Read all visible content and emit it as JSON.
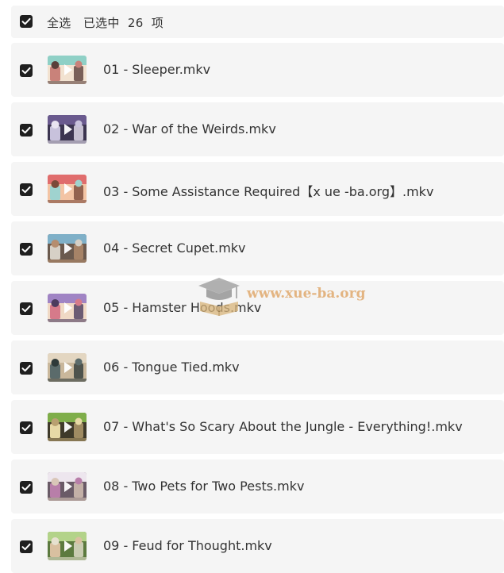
{
  "header": {
    "select_all": "全选",
    "selected_prefix": "已选中",
    "selected_count": "26",
    "selected_suffix": "项",
    "checked": true
  },
  "files": [
    {
      "name": "01 - Sleeper.mkv",
      "checked": true,
      "palette": [
        "#8fd0c6",
        "#c9827a",
        "#f2e2d0",
        "#5a3f3a"
      ]
    },
    {
      "name": "02 - War of the Weirds.mkv",
      "checked": true,
      "palette": [
        "#6a5a8e",
        "#c8c2dc",
        "#3c3550",
        "#e9e4f1"
      ]
    },
    {
      "name": "03 - Some Assistance Required【x ue -ba.org】.mkv",
      "checked": true,
      "palette": [
        "#e06d6d",
        "#9fd3cf",
        "#f3c4a4",
        "#7b4a3a"
      ]
    },
    {
      "name": "04 - Secret Cupet.mkv",
      "checked": true,
      "palette": [
        "#7fb0c8",
        "#d6d0c6",
        "#6b5a4e",
        "#b58d6e"
      ]
    },
    {
      "name": "05 - Hamster Hoods.mkv",
      "checked": true,
      "palette": [
        "#a084c4",
        "#d67a8a",
        "#f0d9c5",
        "#4b3b5e"
      ]
    },
    {
      "name": "06 - Tongue Tied.mkv",
      "checked": true,
      "palette": [
        "#e3d6c1",
        "#5b6b6b",
        "#c9b79b",
        "#2f3a3a"
      ]
    },
    {
      "name": "07 - What's So Scary About the Jungle - Everything!.mkv",
      "checked": true,
      "palette": [
        "#7fae4a",
        "#e7d9a6",
        "#3f3a2a",
        "#b8a070"
      ]
    },
    {
      "name": "08 - Two Pets for Two Pests.mkv",
      "checked": true,
      "palette": [
        "#ede6ee",
        "#b87ea9",
        "#6a5b67",
        "#d9c6b8"
      ]
    },
    {
      "name": "09 - Feud for Thought.mkv",
      "checked": true,
      "palette": [
        "#b3d389",
        "#d9c0a0",
        "#5c7a3f",
        "#e6e1cf"
      ]
    }
  ],
  "watermark": {
    "text": "www.xue-ba.org",
    "icon": "graduation-cap-book-icon"
  },
  "colors": {
    "row_bg": "#f5f5f5",
    "checkbox": "#1f1f1f",
    "text": "#333333",
    "watermark": "#e0a96d"
  }
}
